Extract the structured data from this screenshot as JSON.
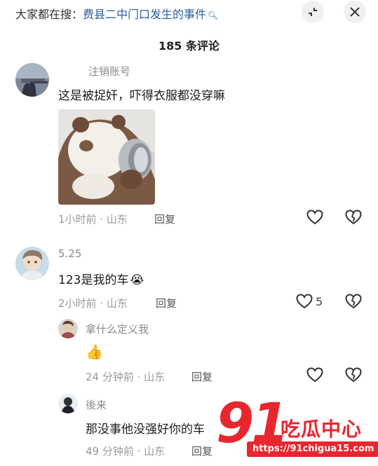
{
  "header": {
    "search_prefix": "大家都在搜：",
    "search_topic": "费县二中门口发生的事件",
    "comment_count": "185 条评论"
  },
  "comments": [
    {
      "username": "注销账号",
      "text": "这是被捉奸，吓得衣服都没穿嘛",
      "meta": "1小时前 · 山东",
      "reply": "回复"
    },
    {
      "username": "5.25",
      "text": "123是我的车",
      "emoji": "😭",
      "meta": "2小时前 · 山东",
      "reply": "回复",
      "likes": "5"
    }
  ],
  "replies": [
    {
      "username": "拿什么定义我",
      "emoji": "👍",
      "meta": "24 分钟前 · 山东",
      "reply": "回复"
    },
    {
      "username": "後来",
      "text": "那没事他没强好你的车",
      "meta": "49 分钟前 · 山东",
      "reply": "回复"
    }
  ],
  "watermark": {
    "number": "91",
    "title": "吃瓜中心",
    "url": "https://91chigua15.com"
  },
  "colors": {
    "topic_link": "#2e5d9e",
    "watermark_red": "#e8262e",
    "meta_gray": "#9a9a9a"
  }
}
